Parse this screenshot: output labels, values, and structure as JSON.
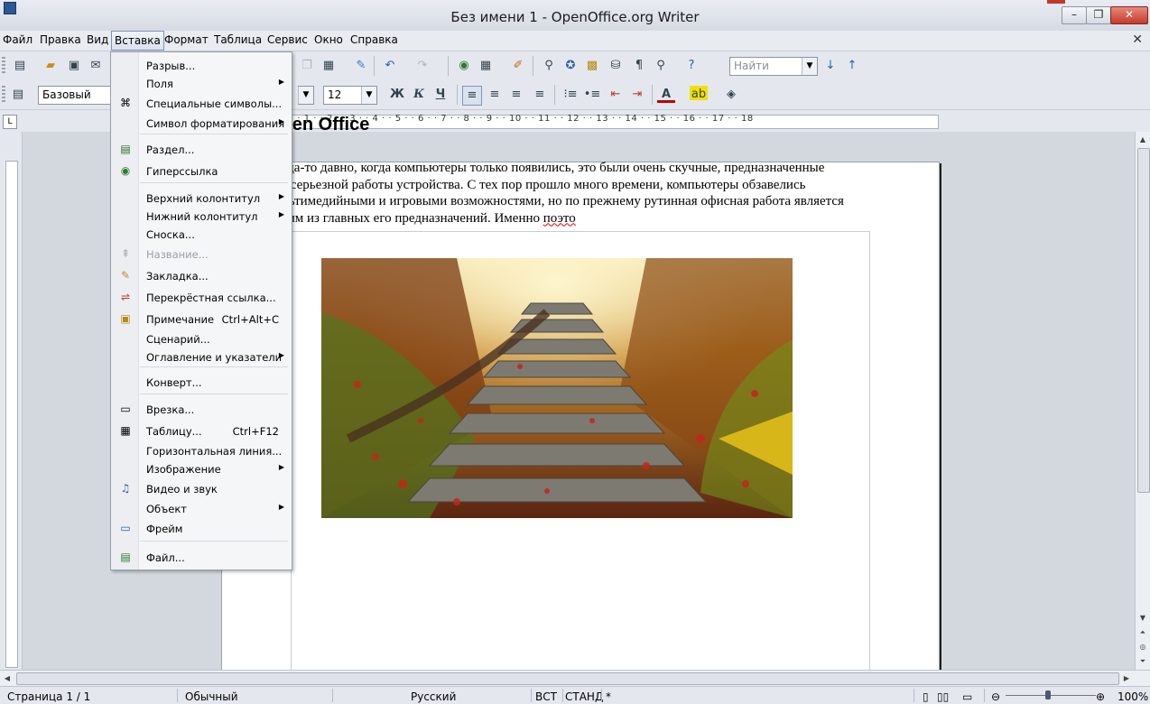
{
  "window": {
    "title": "Без имени 1 - OpenOffice.org Writer",
    "minimize_glyph": "–",
    "restore_glyph": "❐",
    "close_glyph": "✕"
  },
  "menubar": {
    "items": [
      "Файл",
      "Правка",
      "Вид",
      "Вставка",
      "Формат",
      "Таблица",
      "Сервис",
      "Окно",
      "Справка"
    ],
    "active": "Вставка",
    "close_doc_glyph": "✕"
  },
  "toolbar": {
    "search_placeholder": "Найти",
    "paragraph_style": "Базовый",
    "font_size": "12",
    "bold_label": "Ж",
    "italic_label": "К",
    "underline_label": "Ч"
  },
  "ruler": {
    "marks": "· · 1 · · 2 · · 3 · · 4 · · 5 · · 6 · · 7 · · 8 · · 9 · · 10 · · 11 · · 12 · · 13 · · 14 · · 15 · · 16 · · 17 · · 18",
    "tab_selector": "L"
  },
  "insert_menu": {
    "items": [
      {
        "label": "Разрыв...",
        "submenu": false,
        "icon": ""
      },
      {
        "label": "Поля",
        "submenu": true,
        "icon": ""
      },
      {
        "label": "Специальные символы...",
        "submenu": false,
        "icon": "omega-icon"
      },
      {
        "label": "Символ форматирования",
        "submenu": true,
        "icon": ""
      },
      {
        "label": "Раздел...",
        "submenu": false,
        "icon": "section-icon"
      },
      {
        "label": "Гиперссылка",
        "submenu": false,
        "icon": "hyperlink-icon"
      },
      {
        "label": "Верхний колонтитул",
        "submenu": true,
        "icon": ""
      },
      {
        "label": "Нижний колонтитул",
        "submenu": true,
        "icon": ""
      },
      {
        "label": "Сноска...",
        "submenu": false,
        "icon": ""
      },
      {
        "label": "Название...",
        "submenu": false,
        "icon": "caption-icon",
        "disabled": true
      },
      {
        "label": "Закладка...",
        "submenu": false,
        "icon": "bookmark-icon"
      },
      {
        "label": "Перекрёстная ссылка...",
        "submenu": false,
        "icon": "cross-reference-icon"
      },
      {
        "label": "Примечание",
        "submenu": false,
        "icon": "comment-icon",
        "shortcut": "Ctrl+Alt+C"
      },
      {
        "label": "Сценарий...",
        "submenu": false,
        "icon": ""
      },
      {
        "label": "Оглавление и указатели",
        "submenu": true,
        "icon": ""
      },
      {
        "label": "Конверт...",
        "submenu": false,
        "icon": ""
      },
      {
        "label": "Врезка...",
        "submenu": false,
        "icon": "frame-icon"
      },
      {
        "label": "Таблицу...",
        "submenu": false,
        "icon": "table-icon",
        "shortcut": "Ctrl+F12"
      },
      {
        "label": "Горизонтальная линия...",
        "submenu": false,
        "icon": ""
      },
      {
        "label": "Изображение",
        "submenu": true,
        "icon": ""
      },
      {
        "label": "Видео и звук",
        "submenu": false,
        "icon": "media-icon"
      },
      {
        "label": "Объект",
        "submenu": true,
        "icon": ""
      },
      {
        "label": "Фрейм",
        "submenu": false,
        "icon": "floating-frame-icon"
      },
      {
        "label": "Файл...",
        "submenu": false,
        "icon": "insert-file-icon"
      }
    ]
  },
  "document": {
    "heading": "Open Office",
    "body_before": "Когда-то давно, когда компьютеры только появились, это были очень скучные, предназначенные для серьезной работы устройства. С тех пор прошло много времени, компьютеры обзавелись мультимедийными и игровыми возможностями, но по прежнему рутинная офисная работа является одним из главных его предназначений. Именно ",
    "body_misspelled": "поэто"
  },
  "statusbar": {
    "page": "Страница  1 / 1",
    "style": "Обычный",
    "language": "Русский",
    "insert_mode": "ВСТ",
    "selection_mode": "СТАНД",
    "modified": "*",
    "zoom": "100%"
  },
  "colors": {
    "accent": "#2b5797",
    "font_color": "#c00000",
    "highlight": "#f0e000"
  }
}
